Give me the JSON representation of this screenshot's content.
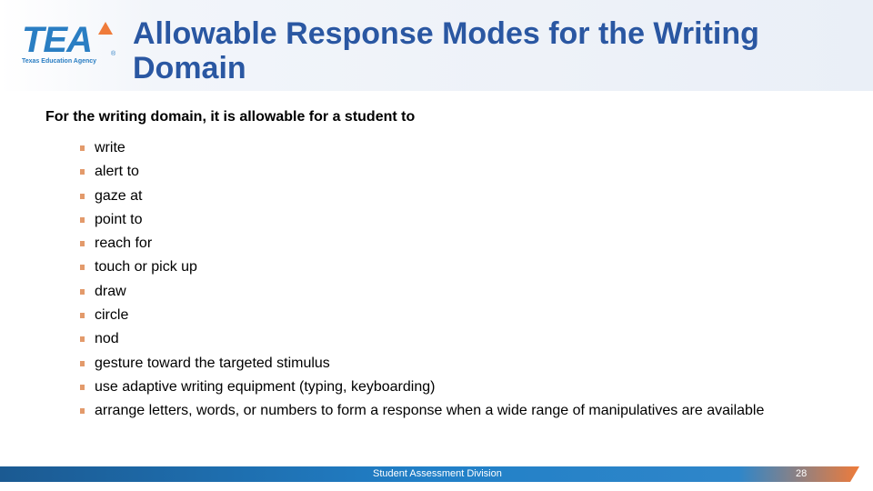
{
  "header": {
    "logo": {
      "wordmark": "TEA",
      "subtitle": "Texas Education Agency",
      "registered_mark": "®",
      "brand_color": "#2a7ec3",
      "accent_color": "#ef7b3a"
    },
    "title": "Allowable Response Modes for the Writing Domain",
    "title_color": "#2a57a2"
  },
  "body": {
    "intro": "For the writing domain, it is allowable for a student to",
    "bullet_color": "#e39a6b",
    "items": [
      {
        "label": "write"
      },
      {
        "label": "alert to"
      },
      {
        "label": "gaze at"
      },
      {
        "label": "point to"
      },
      {
        "label": "reach for"
      },
      {
        "label": "touch or pick up"
      },
      {
        "label": "draw"
      },
      {
        "label": "circle"
      },
      {
        "label": "nod"
      },
      {
        "label": "gesture toward the targeted stimulus"
      },
      {
        "label": "use adaptive writing equipment (typing, keyboarding)"
      },
      {
        "label": "arrange letters, words, or numbers to form a response when a wide range of manipulatives are available"
      }
    ]
  },
  "footer": {
    "division": "Student Assessment Division",
    "page_number": "28",
    "bar_color_start": "#1b5a92",
    "bar_color_mid": "#2180c8",
    "bar_color_end": "#ef7b3a"
  }
}
